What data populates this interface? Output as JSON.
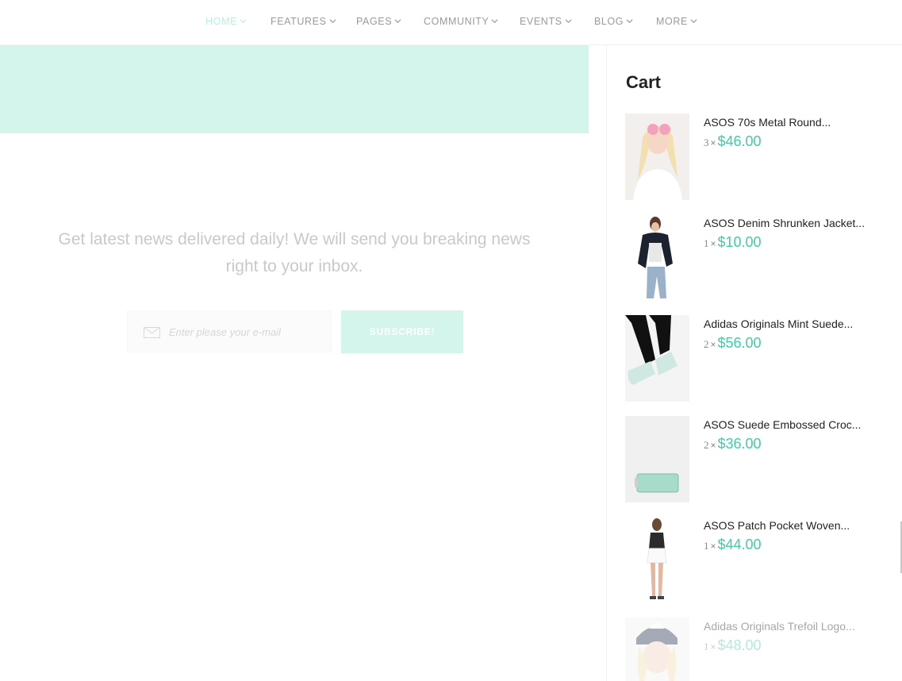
{
  "nav": {
    "items": [
      {
        "label": "HOME",
        "active": true
      },
      {
        "label": "FEATURES",
        "active": false
      },
      {
        "label": "PAGES",
        "active": false
      },
      {
        "label": "COMMUNITY",
        "active": false
      },
      {
        "label": "EVENTS",
        "active": false
      },
      {
        "label": "BLOG",
        "active": false
      },
      {
        "label": "MORE",
        "active": false
      }
    ]
  },
  "newsletter": {
    "text": "Get latest news delivered daily! We will send you breaking news right to your inbox.",
    "email_placeholder": "Enter please your e-mail",
    "subscribe_label": "SUBSCRIBE!"
  },
  "cart": {
    "title": "Cart",
    "currency_sign": "×",
    "items": [
      {
        "name": "ASOS 70s Metal Round...",
        "qty": "3",
        "price": "$46.00",
        "icon": "sunglasses-model-photo"
      },
      {
        "name": "ASOS Denim Shrunken Jacket...",
        "qty": "1",
        "price": "$10.00",
        "icon": "denim-jacket-model-photo"
      },
      {
        "name": "Adidas Originals Mint Suede...",
        "qty": "2",
        "price": "$56.00",
        "icon": "mint-sneakers-photo"
      },
      {
        "name": "ASOS Suede Embossed Croc...",
        "qty": "2",
        "price": "$36.00",
        "icon": "mint-wallet-photo"
      },
      {
        "name": "ASOS Patch Pocket Woven...",
        "qty": "1",
        "price": "$44.00",
        "icon": "shorts-model-photo"
      },
      {
        "name": "Adidas Originals Trefoil Logo...",
        "qty": "1",
        "price": "$48.00",
        "icon": "cap-model-photo"
      }
    ]
  },
  "colors": {
    "accent": "#3fcca6",
    "mint": "#d4f5ec"
  }
}
